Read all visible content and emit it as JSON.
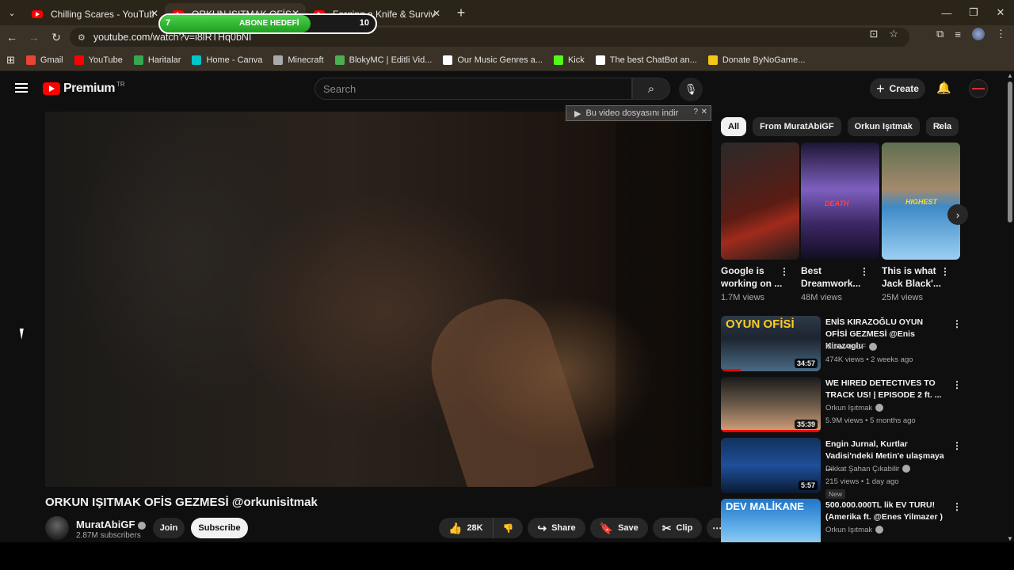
{
  "browser": {
    "tabs": [
      {
        "title": "Chilling Scares - YouTube",
        "active": false
      },
      {
        "title": "ORKUN IŞITMAK OFİS GEZMESİ",
        "active": true
      },
      {
        "title": "Forging a Knife & Survival Camp",
        "active": false
      }
    ],
    "url": "youtube.com/watch?v=i8lRTHq0bNI",
    "bookmarks": [
      {
        "label": "Gmail",
        "color": "#ea4335"
      },
      {
        "label": "YouTube",
        "color": "#ff0000"
      },
      {
        "label": "Haritalar",
        "color": "#34a853"
      },
      {
        "label": "Home - Canva",
        "color": "#00c4cc"
      },
      {
        "label": "Minecraft",
        "color": "#aaaaaa"
      },
      {
        "label": "BlokyMC | Editli Vid...",
        "color": "#4caf50"
      },
      {
        "label": "Our Music Genres a...",
        "color": "#ffffff"
      },
      {
        "label": "Kick",
        "color": "#53fc18"
      },
      {
        "label": "The best ChatBot an...",
        "color": "#ffffff"
      },
      {
        "label": "Donate ByNoGame...",
        "color": "#f5c518"
      }
    ]
  },
  "abone_hedefi": {
    "current": "7",
    "label": "ABONE HEDEFİ",
    "goal": "10",
    "progress_fraction": 0.7,
    "color": "#3cc43c"
  },
  "masthead": {
    "brand": "Premium",
    "region": "TR",
    "search_placeholder": "Search",
    "create_label": "Create"
  },
  "download_bar": {
    "label": "Bu video dosyasını indir",
    "help": "?",
    "close": "✕"
  },
  "video": {
    "title": "ORKUN IŞITMAK OFİS GEZMESİ @orkunisitmak",
    "channel": "MuratAbiGF",
    "subscribers": "2.87M subscribers",
    "join_label": "Join",
    "subscribe_label": "Subscribe",
    "likes": "28K",
    "share_label": "Share",
    "save_label": "Save",
    "clip_label": "Clip"
  },
  "chips": [
    "All",
    "From MuratAbiGF",
    "Orkun Işıtmak",
    "Rela"
  ],
  "shorts": [
    {
      "title": "Google is working on ...",
      "views": "1.7M views"
    },
    {
      "title": "Best Dreamwork...",
      "views": "48M views",
      "tag": "DEATH"
    },
    {
      "title": "This is what Jack Black'...",
      "views": "25M views",
      "tag": "HIGHEST"
    }
  ],
  "recommendations": [
    {
      "title": "ENİS KIRAZOĞLU OYUN OFİSİ GEZMESİ @Enis Kirazoglu",
      "channel": "MuratAbiGF",
      "meta": "474K views • 2 weeks ago",
      "duration": "34:57",
      "thumb_text": "OYUN OFİSİ",
      "watched_fraction": 0.2,
      "new": ""
    },
    {
      "title": "WE HIRED DETECTIVES TO TRACK US! | EPISODE 2 ft. ...",
      "channel": "Orkun Işıtmak",
      "meta": "5.9M views • 5 months ago",
      "duration": "35:39",
      "thumb_text": "",
      "watched_fraction": 1.0,
      "new": ""
    },
    {
      "title": "Engin Jurnal, Kurtlar Vadisi'ndeki Metin'e ulaşmaya ...",
      "channel": "Dikkat Şahan Çıkabilir",
      "meta": "215 views • 1 day ago",
      "duration": "5:57",
      "thumb_text": "",
      "watched_fraction": 0,
      "new": "New"
    },
    {
      "title": "500.000.000TL lik EV TURU! (Amerika ft. @Enes Yilmazer )",
      "channel": "Orkun Işıtmak",
      "meta": "",
      "duration": "",
      "thumb_text": "DEV MALİKANE",
      "watched_fraction": 0,
      "new": ""
    }
  ]
}
